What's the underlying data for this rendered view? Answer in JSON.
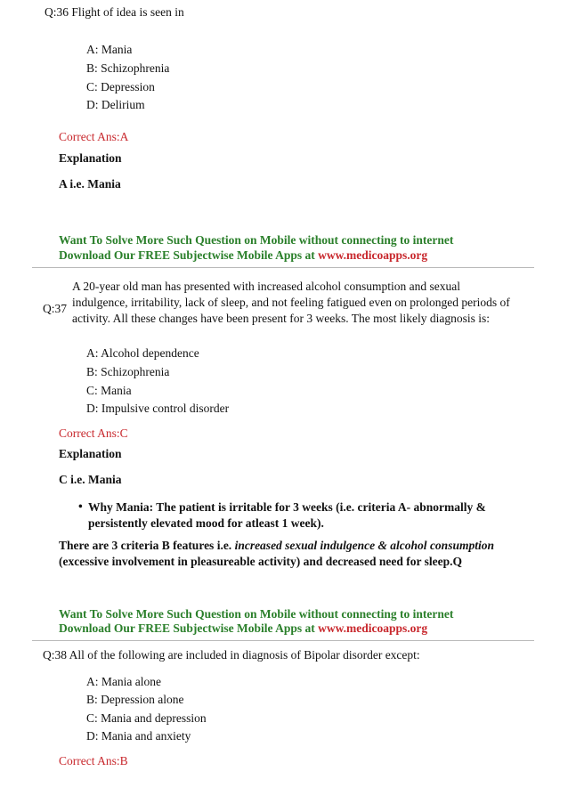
{
  "questions": [
    {
      "number": "Q:36",
      "text": "Flight of idea is seen in",
      "options": [
        "A: Mania",
        "B: Schizophrenia",
        "C: Depression",
        "D: Delirium"
      ],
      "correct": "Correct Ans:A",
      "explanation_heading": "Explanation",
      "explanation": "A i.e. Mania"
    },
    {
      "number": "Q:37",
      "text": "A 20-year old man has presented with increased alcohol consumption and sexual indulgence, irritability, lack of sleep, and not feeling fatigued even on prolonged periods of activity. All these changes have been present for 3 weeks. The most likely diagnosis is:",
      "options": [
        "A: Alcohol dependence",
        "B: Schizophrenia",
        "C: Mania",
        "D: Impulsive control disorder"
      ],
      "correct": "Correct Ans:C",
      "explanation_heading": "Explanation",
      "explanation": "C i.e. Mania",
      "bullet": "Why Mania: The patient is irritable for 3 weeks (i.e. criteria A- abnormally & persistently elevated mood for atleast 1 week).",
      "para_start": "There are 3 criteria B features i.e. ",
      "para_italic": "increased sexual indulgence & alcohol consumption",
      "para_end": " (excessive involvement in pleasureable activity) and decreased need for sleep.Q"
    },
    {
      "number": "Q:38",
      "text": "All of the following are included in diagnosis of Bipolar disorder except:",
      "options": [
        "A: Mania alone",
        "B: Depression alone",
        "C: Mania and depression",
        "D: Mania and anxiety"
      ],
      "correct": "Correct Ans:B"
    }
  ],
  "promo": {
    "line1": "Want To Solve More Such Question on Mobile without connecting to internet",
    "line2": "Download Our FREE Subjectwise Mobile Apps at ",
    "link": "www.medicoapps.org"
  },
  "colors": {
    "answer_red": "#c8282d",
    "promo_green": "#2a7f2a",
    "link_red": "#c8282d"
  }
}
